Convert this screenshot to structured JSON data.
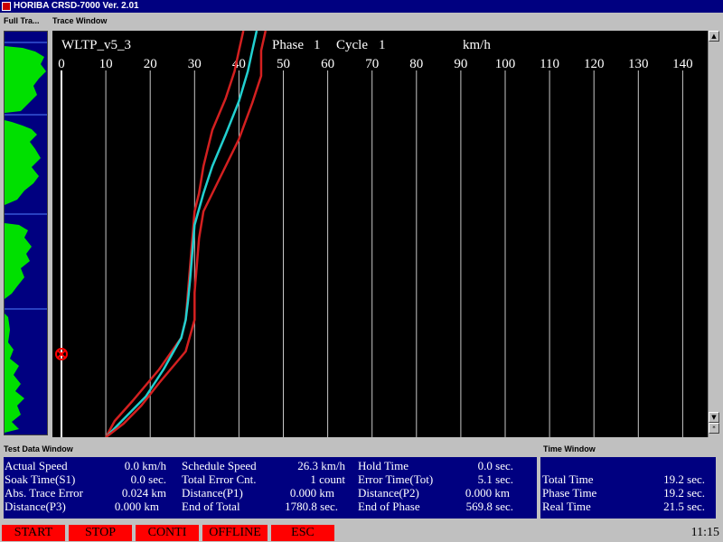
{
  "app": {
    "title": "HORIBA CRSD-7000 Ver. 2.01"
  },
  "full_trace": {
    "header": "Full Tra..."
  },
  "trace_window": {
    "header": "Trace Window",
    "cycle_name": "WLTP_v5_3",
    "phase_label": "Phase",
    "phase_value": "1",
    "cycle_label": "Cycle",
    "cycle_value": "1",
    "unit": "km/h",
    "axis_ticks": [
      "0",
      "10",
      "20",
      "30",
      "40",
      "50",
      "60",
      "70",
      "80",
      "90",
      "100",
      "110",
      "120",
      "130",
      "140"
    ]
  },
  "chart_data": {
    "type": "line",
    "title": "",
    "xlabel": "km/h",
    "xlim": [
      0,
      145
    ],
    "ylim": [
      0,
      450
    ],
    "series": [
      {
        "role": "upper-limit",
        "color": "#d42020",
        "points": [
          [
            41,
            0
          ],
          [
            40,
            22
          ],
          [
            39,
            45
          ],
          [
            37,
            75
          ],
          [
            34,
            110
          ],
          [
            32,
            150
          ],
          [
            31,
            180
          ],
          [
            30,
            200
          ],
          [
            29.5,
            230
          ],
          [
            29,
            260
          ],
          [
            28.5,
            290
          ],
          [
            28,
            320
          ],
          [
            27,
            340
          ],
          [
            22,
            375
          ],
          [
            16,
            410
          ],
          [
            12,
            432
          ],
          [
            10,
            450
          ]
        ]
      },
      {
        "role": "schedule-speed",
        "color": "#22d0d0",
        "points": [
          [
            44,
            0
          ],
          [
            43,
            22
          ],
          [
            42,
            45
          ],
          [
            40,
            78
          ],
          [
            37,
            115
          ],
          [
            34,
            150
          ],
          [
            32,
            180
          ],
          [
            30,
            215
          ],
          [
            29.5,
            245
          ],
          [
            29,
            275
          ],
          [
            28.5,
            300
          ],
          [
            28,
            320
          ],
          [
            27,
            340
          ],
          [
            23,
            375
          ],
          [
            19,
            405
          ],
          [
            15,
            425
          ],
          [
            10,
            450
          ]
        ]
      },
      {
        "role": "lower-limit",
        "color": "#d42020",
        "points": [
          [
            46,
            0
          ],
          [
            45,
            22
          ],
          [
            45,
            50
          ],
          [
            43,
            80
          ],
          [
            40,
            120
          ],
          [
            37,
            150
          ],
          [
            34,
            180
          ],
          [
            32,
            200
          ],
          [
            31,
            230
          ],
          [
            30.5,
            260
          ],
          [
            30,
            290
          ],
          [
            30,
            320
          ],
          [
            28,
            355
          ],
          [
            22,
            390
          ],
          [
            18,
            415
          ],
          [
            14,
            435
          ],
          [
            10,
            450
          ]
        ]
      }
    ],
    "cursor": {
      "speed": 0,
      "color": "#ff0000"
    },
    "grid": true
  },
  "test_data": {
    "header": "Test Data Window",
    "rows": [
      [
        {
          "label": "Actual Speed",
          "value": "0.0 km/h"
        },
        {
          "label": "Schedule Speed",
          "value": "26.3 km/h"
        },
        {
          "label": "Hold Time",
          "value": "0.0 sec."
        }
      ],
      [
        {
          "label": "Soak Time(S1)",
          "value": "0.0 sec."
        },
        {
          "label": "Total Error Cnt.",
          "value": "1 count"
        },
        {
          "label": "Error Time(Tot)",
          "value": "5.1 sec."
        }
      ],
      [
        {
          "label": "Abs. Trace Error",
          "value": "0.024 km"
        },
        {
          "label": "Distance(P1)",
          "value": "0.000 km"
        },
        {
          "label": "Distance(P2)",
          "value": "0.000 km"
        }
      ],
      [
        {
          "label": "Distance(P3)",
          "value": "0.000 km"
        },
        {
          "label": "End of Total",
          "value": "1780.8 sec."
        },
        {
          "label": "End of Phase",
          "value": "569.8 sec."
        }
      ]
    ]
  },
  "time_window": {
    "header": "Time Window",
    "rows": [
      {
        "label": "Total Time",
        "value": "19.2 sec."
      },
      {
        "label": "Phase Time",
        "value": "19.2 sec."
      },
      {
        "label": "Real Time",
        "value": "21.5 sec."
      }
    ]
  },
  "function_keys": [
    "START",
    "STOP",
    "CONTI",
    "OFFLINE",
    "ESC"
  ],
  "clock": "11:15"
}
